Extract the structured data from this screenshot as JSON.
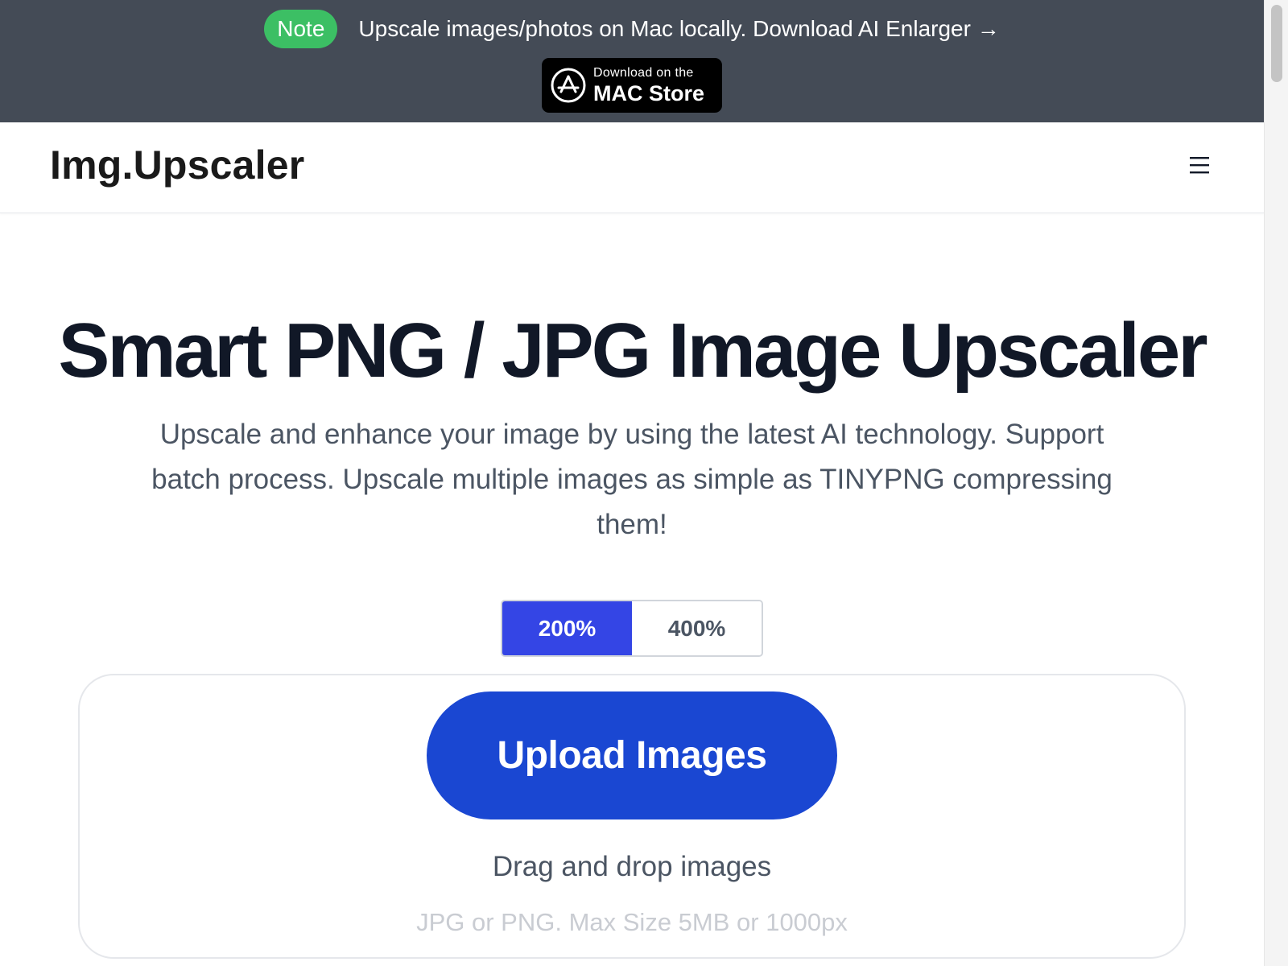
{
  "announcement": {
    "badge": "Note",
    "link_text": "Upscale images/photos on Mac locally. Download AI Enlarger →",
    "store_button": {
      "small_text": "Download on the",
      "big_text": "MAC Store",
      "icon": "app-store-icon"
    }
  },
  "header": {
    "logo": "Img.Upscaler",
    "menu_icon": "hamburger-menu-icon"
  },
  "hero": {
    "title": "Smart PNG / JPG Image Upscaler",
    "subtitle": "Upscale and enhance your image by using the latest AI technology. Support batch process. Upscale multiple images as simple as TINYPNG compressing them!"
  },
  "scale_options": [
    {
      "label": "200%",
      "selected": true
    },
    {
      "label": "400%",
      "selected": false
    }
  ],
  "upload": {
    "button_label": "Upload Images",
    "drag_text": "Drag and drop images",
    "limits_text": "JPG or PNG. Max Size 5MB or 1000px"
  },
  "colors": {
    "announcement_bg": "#444b56",
    "badge_green": "#3cbf64",
    "scale_active": "#3445e5",
    "upload_button": "#1a47d2"
  }
}
